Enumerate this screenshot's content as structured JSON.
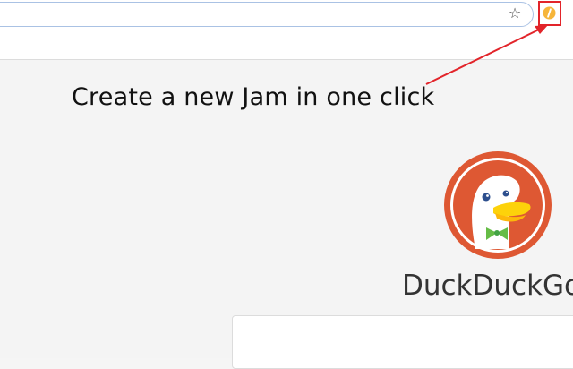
{
  "browser": {
    "bookmark_icon": "star-icon",
    "extension_icon": "jam-extension-icon",
    "highlight_color": "#e2242a"
  },
  "annotation": {
    "caption": "Create a new Jam in one click",
    "arrow_color": "#e2242a"
  },
  "page": {
    "brand_name": "DuckDuckGo",
    "logo_icon": "duckduckgo-logo-icon"
  }
}
